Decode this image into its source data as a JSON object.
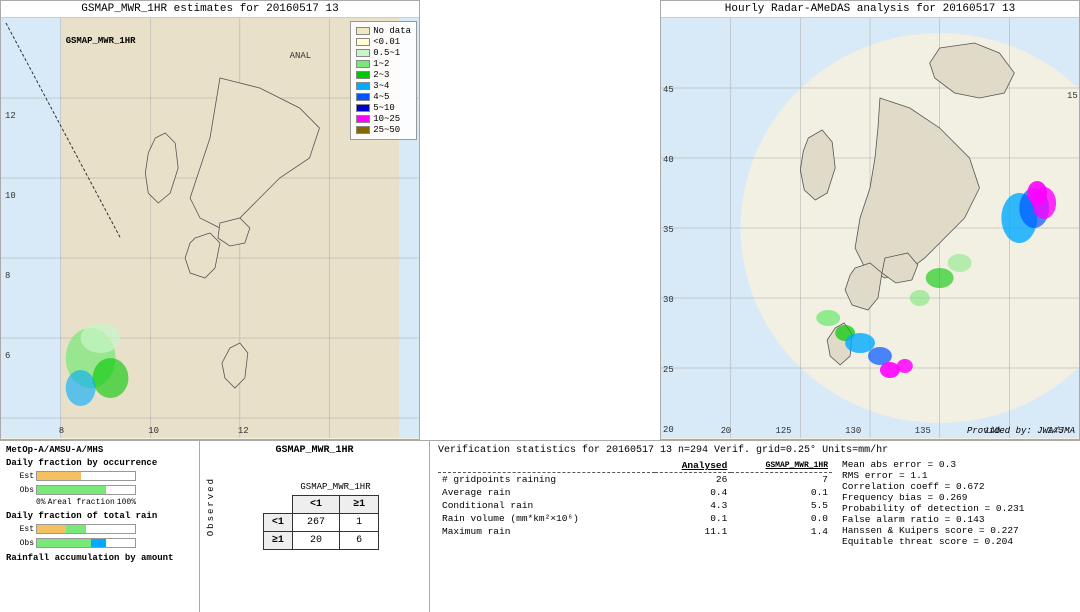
{
  "titles": {
    "left_map": "GSMAP_MWR_1HR estimates for 20160517 13",
    "right_map": "Hourly Radar-AMeDAS analysis for 20160517 13"
  },
  "legend": {
    "items": [
      {
        "label": "No data",
        "color": "#f0e8c0"
      },
      {
        "label": "<0.01",
        "color": "#ffffcc"
      },
      {
        "label": "0.5~1",
        "color": "#c8f5c8"
      },
      {
        "label": "1~2",
        "color": "#78e878"
      },
      {
        "label": "2~3",
        "color": "#00c800"
      },
      {
        "label": "3~4",
        "color": "#00aaff"
      },
      {
        "label": "4~5",
        "color": "#0055ff"
      },
      {
        "label": "5~10",
        "color": "#0000cc"
      },
      {
        "label": "10~25",
        "color": "#ff00ff"
      },
      {
        "label": "25~50",
        "color": "#886600"
      }
    ]
  },
  "bottom_left": {
    "satellite_label": "MetOp-A/AMSU-A/MHS",
    "occurrence_title": "Daily fraction by occurrence",
    "rain_title": "Daily fraction of total rain",
    "accumulation_title": "Rainfall accumulation by amount",
    "est_label": "Est",
    "obs_label": "Obs",
    "x_axis_start": "0%",
    "x_axis_end": "100%",
    "x_axis_label": "Areal fraction"
  },
  "contingency": {
    "title": "GSMAP_MWR_1HR",
    "col_less1": "<1",
    "col_ge1": "≥1",
    "row_less1": "<1",
    "row_ge1": "≥1",
    "observed_label": "O\nb\ns\ne\nr\nv\ne\nd",
    "val_267": "267",
    "val_1": "1",
    "val_20": "20",
    "val_6": "6"
  },
  "verification": {
    "header": "Verification statistics for 20160517 13  n=294  Verif. grid=0.25°  Units=mm/hr",
    "col_analysed": "Analysed",
    "col_gsmap": "GSMAP_MWR_1HR",
    "rows": [
      {
        "label": "# gridpoints raining",
        "analysed": "26",
        "gsmap": "7"
      },
      {
        "label": "Average rain",
        "analysed": "0.4",
        "gsmap": "0.1"
      },
      {
        "label": "Conditional rain",
        "analysed": "4.3",
        "gsmap": "5.5"
      },
      {
        "label": "Rain volume (mm*km²×10⁶)",
        "analysed": "0.1",
        "gsmap": "0.0"
      },
      {
        "label": "Maximum rain",
        "analysed": "11.1",
        "gsmap": "1.4"
      }
    ],
    "stats_right": [
      {
        "label": "Mean abs error = 0.3"
      },
      {
        "label": "RMS error = 1.1"
      },
      {
        "label": "Correlation coeff = 0.672"
      },
      {
        "label": "Frequency bias = 0.269"
      },
      {
        "label": "Probability of detection = 0.231"
      },
      {
        "label": "False alarm ratio = 0.143"
      },
      {
        "label": "Hanssen & Kuipers score = 0.227"
      },
      {
        "label": "Equitable threat score = 0.204"
      }
    ]
  },
  "map_axes": {
    "left_lat": [
      "12",
      "10",
      "8",
      "6"
    ],
    "left_lon": [
      "8",
      "10",
      "12"
    ],
    "left_anal_label": "ANAL",
    "right_lat": [
      "45",
      "40",
      "35",
      "30",
      "25",
      "20"
    ],
    "right_lon": [
      "125",
      "130",
      "135",
      "140",
      "145"
    ],
    "right_extra": "15"
  },
  "provided_by": "Provided by: JWA/JMA"
}
